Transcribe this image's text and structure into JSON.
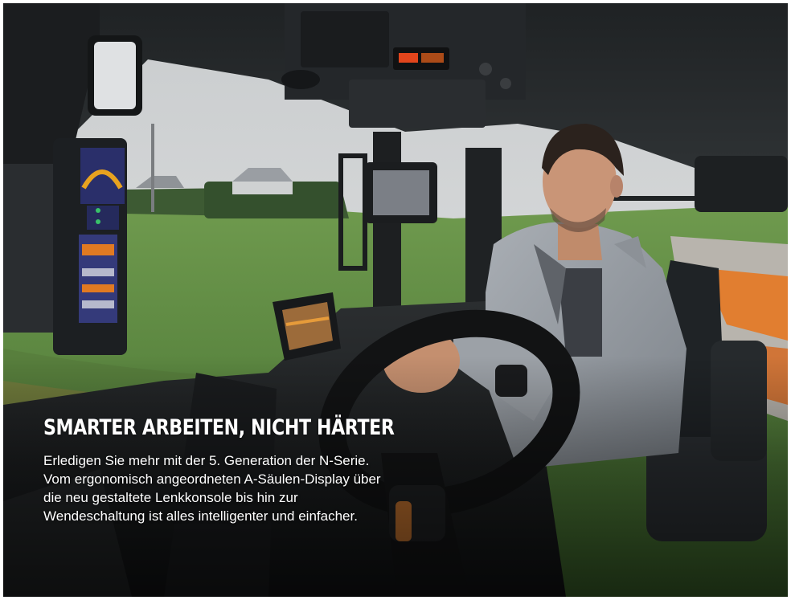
{
  "hero": {
    "headline": "SMARTER ARBEITEN, NICHT HÄRTER",
    "body": "Erledigen Sie mehr mit der 5. Generation der N-Serie. Vom ergonomisch angeordneten A-Säulen-Display über die neu gestaltete Lenkkonsole bis hin zur Wendeschaltung ist alles intelligenter und einfacher."
  },
  "colors": {
    "text": "#ffffff",
    "page_background": "#ffffff",
    "accent_orange": "#e8741a"
  }
}
